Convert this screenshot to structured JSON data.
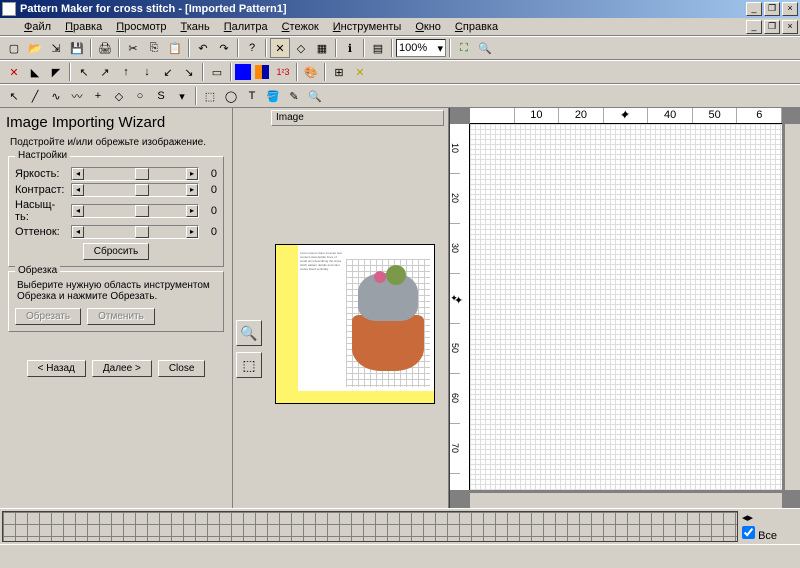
{
  "titlebar": {
    "title": "Pattern Maker for cross stitch - [Imported Pattern1]"
  },
  "menu": [
    "Файл",
    "Правка",
    "Просмотр",
    "Ткань",
    "Палитра",
    "Стежок",
    "Инструменты",
    "Окно",
    "Справка"
  ],
  "zoom": "100%",
  "wizard": {
    "title": "Image Importing Wizard",
    "intro": "Подстройте и/или обрежьте изображение.",
    "settings_legend": "Настройки",
    "sliders": [
      {
        "label": "Яркость:",
        "val": "0"
      },
      {
        "label": "Контраст:",
        "val": "0"
      },
      {
        "label": "Насыщ-ть:",
        "val": "0"
      },
      {
        "label": "Оттенок:",
        "val": "0"
      }
    ],
    "reset": "Сбросить",
    "crop_legend": "Обрезка",
    "crop_text": "Выберите нужную область инструментом Обрезка и нажмите Обрезать.",
    "crop_btn": "Обрезать",
    "cancel_btn": "Отменить",
    "back": "< Назад",
    "next": "Далее >",
    "close": "Close"
  },
  "preview": {
    "label": "Image"
  },
  "ruler_h": [
    "",
    "10",
    "20",
    "✦",
    "40",
    "50",
    "6"
  ],
  "ruler_v": [
    "10",
    "20",
    "30",
    "✦",
    "50",
    "60",
    "70"
  ],
  "palette": {
    "all_label": "Все"
  }
}
